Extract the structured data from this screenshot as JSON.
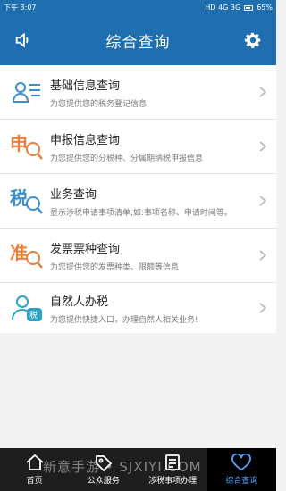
{
  "status_bar": {
    "time": "下午 3:07",
    "network_text": "HD 4G 3G",
    "battery": "65%"
  },
  "header": {
    "title": "综合查询",
    "left_icon": "speaker-icon",
    "right_icon": "gear-icon"
  },
  "list": {
    "items": [
      {
        "title": "基础信息查询",
        "subtitle": "为您提供您的税务登记信息",
        "icon": "person-id-icon",
        "icon_color": "#3b8fd0"
      },
      {
        "title": "申报信息查询",
        "subtitle": "为您提供您的分税种、分属期纳税申报信息",
        "icon": "shen-search-icon",
        "icon_color": "#e8803c"
      },
      {
        "title": "业务查询",
        "subtitle": "显示涉税申请事项清单,如:事项名称、申请时间等。",
        "icon": "shui-search-icon",
        "icon_color": "#3b8fd0"
      },
      {
        "title": "发票票种查询",
        "subtitle": "为您提供您的发票种类、限额等信息",
        "icon": "zhun-search-icon",
        "icon_color": "#e8803c"
      },
      {
        "title": "自然人办税",
        "subtitle": "为您提供快捷入口，办理自然人相关业务!",
        "icon": "person-tax-icon",
        "icon_color": "#2aa3c9"
      }
    ]
  },
  "tabbar": {
    "tabs": [
      {
        "label": "首页",
        "icon": "home-icon"
      },
      {
        "label": "公众服务",
        "icon": "tag-icon"
      },
      {
        "label": "涉税事项办理",
        "icon": "document-icon"
      },
      {
        "label": "综合查询",
        "icon": "heart-icon",
        "active": true
      }
    ]
  },
  "watermark": "新意手游 • SJXIYI.COM"
}
